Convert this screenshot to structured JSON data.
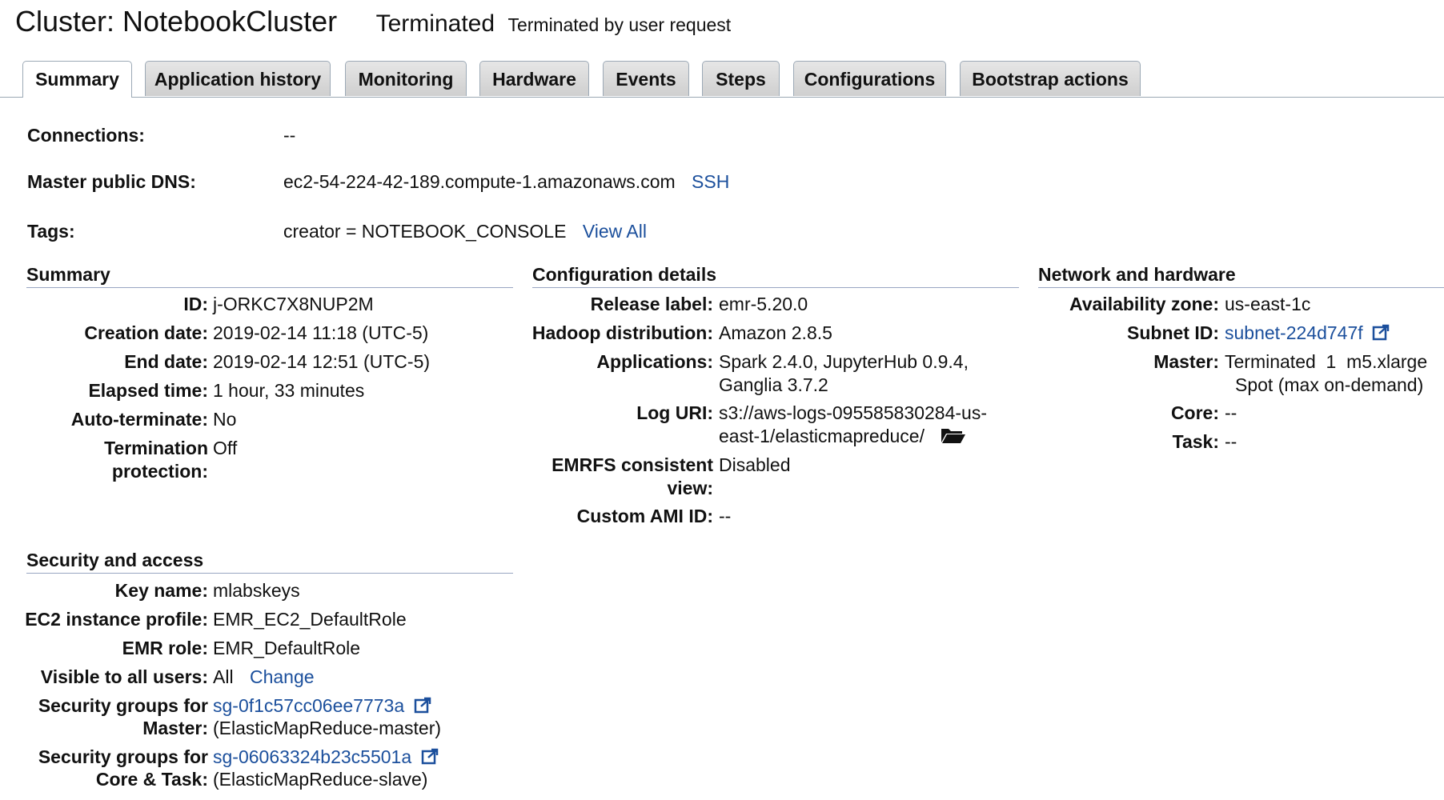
{
  "header": {
    "title": "Cluster: NotebookCluster",
    "status": "Terminated",
    "status_reason": "Terminated by user request"
  },
  "tabs": [
    {
      "label": "Summary"
    },
    {
      "label": "Application history"
    },
    {
      "label": "Monitoring"
    },
    {
      "label": "Hardware"
    },
    {
      "label": "Events"
    },
    {
      "label": "Steps"
    },
    {
      "label": "Configurations"
    },
    {
      "label": "Bootstrap actions"
    }
  ],
  "overview": {
    "connections_label": "Connections:",
    "connections_value": "--",
    "dns_label": "Master public DNS:",
    "dns_value": "ec2-54-224-42-189.compute-1.amazonaws.com",
    "ssh_link": "SSH",
    "tags_label": "Tags:",
    "tags_value": "creator = NOTEBOOK_CONSOLE",
    "view_all_link": "View All"
  },
  "summary": {
    "title": "Summary",
    "id_label": "ID:",
    "id_value": "j-ORKC7X8NUP2M",
    "creation_label": "Creation date:",
    "creation_value": "2019-02-14 11:18 (UTC-5)",
    "end_label": "End date:",
    "end_value": "2019-02-14 12:51 (UTC-5)",
    "elapsed_label": "Elapsed time:",
    "elapsed_value": "1 hour, 33 minutes",
    "autoterm_label": "Auto-terminate:",
    "autoterm_value": "No",
    "termprot_label_1": "Termination",
    "termprot_label_2": "protection:",
    "termprot_value": "Off"
  },
  "config": {
    "title": "Configuration details",
    "release_label": "Release label:",
    "release_value": "emr-5.20.0",
    "hadoop_label": "Hadoop distribution:",
    "hadoop_value": "Amazon 2.8.5",
    "apps_label": "Applications:",
    "apps_value_1": "Spark 2.4.0, JupyterHub 0.9.4,",
    "apps_value_2": "Ganglia 3.7.2",
    "log_label": "Log URI:",
    "log_value_1": "s3://aws-logs-095585830284-us-",
    "log_value_2": "east-1/elasticmapreduce/",
    "emrfs_label_1": "EMRFS consistent",
    "emrfs_label_2": "view:",
    "emrfs_value": "Disabled",
    "ami_label": "Custom AMI ID:",
    "ami_value": "--"
  },
  "network": {
    "title": "Network and hardware",
    "az_label": "Availability zone:",
    "az_value": "us-east-1c",
    "subnet_label": "Subnet ID:",
    "subnet_value": "subnet-224d747f",
    "master_label": "Master:",
    "master_value_1": "Terminated  1  m5.xlarge",
    "master_value_2": "Spot (max on-demand)",
    "core_label": "Core:",
    "core_value": "--",
    "task_label": "Task:",
    "task_value": "--"
  },
  "security": {
    "title": "Security and access",
    "key_label": "Key name:",
    "key_value": "mlabskeys",
    "profile_label": "EC2 instance profile:",
    "profile_value": "EMR_EC2_DefaultRole",
    "role_label": "EMR role:",
    "role_value": "EMR_DefaultRole",
    "visible_label": "Visible to all users:",
    "visible_value": "All",
    "change_link": "Change",
    "sg_master_label_1": "Security groups for",
    "sg_master_label_2": "Master:",
    "sg_master_value": "sg-0f1c57cc06ee7773a",
    "sg_master_desc": "(ElasticMapReduce-master)",
    "sg_core_label_1": "Security groups for",
    "sg_core_label_2": "Core & Task:",
    "sg_core_value": "sg-06063324b23c5501a",
    "sg_core_desc": "(ElasticMapReduce-slave)"
  },
  "colors": {
    "link": "#1b4f9c",
    "rule": "#98a6c2"
  }
}
